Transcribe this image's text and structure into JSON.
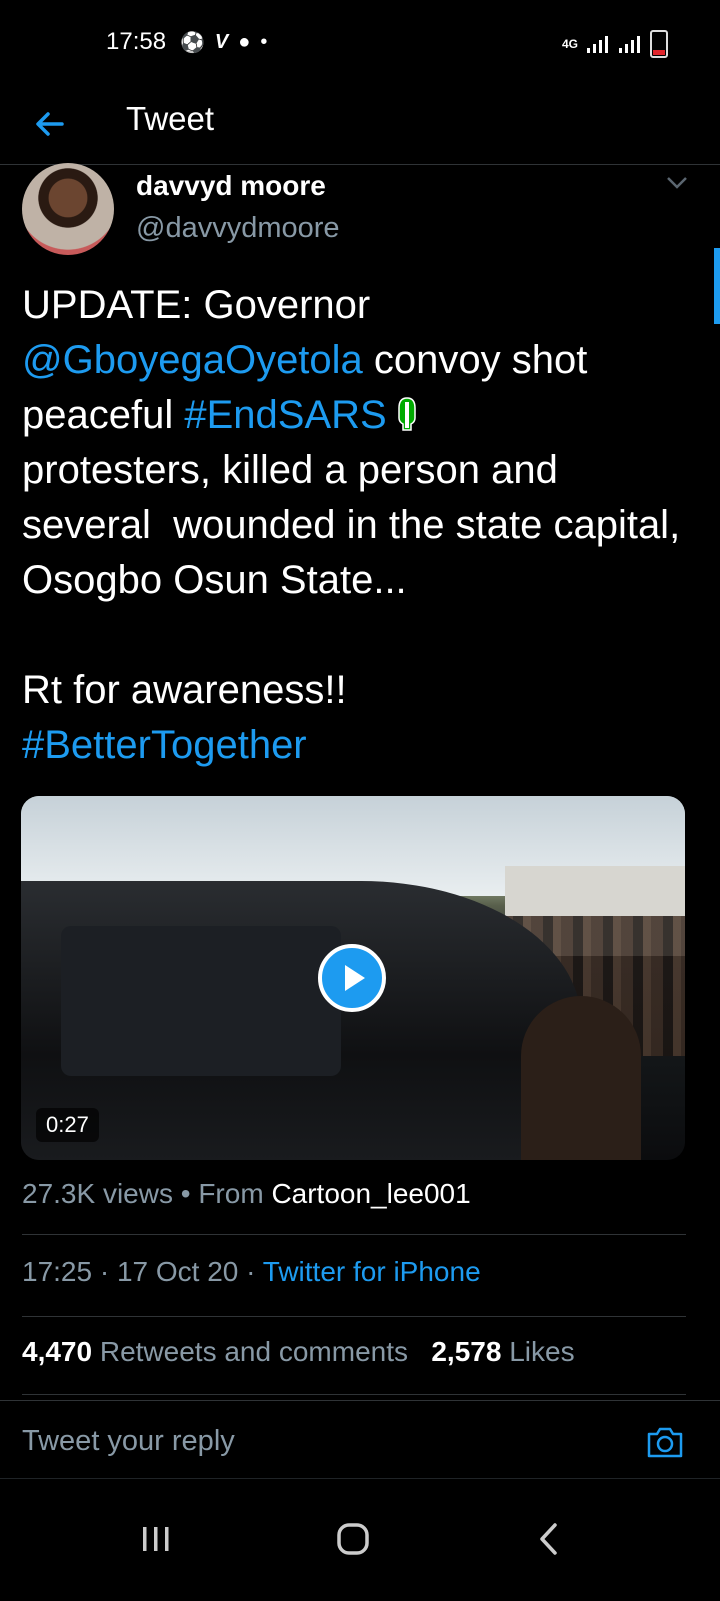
{
  "status_bar": {
    "time": "17:58",
    "left_icons": [
      "soccer-ball-icon",
      "v-icon",
      "whatsapp-icon",
      "dot-icon"
    ],
    "left_glyphs": [
      "⚽",
      "V",
      "●",
      "•"
    ],
    "network_label": "4G",
    "battery_level": 0.15
  },
  "header": {
    "title": "Tweet"
  },
  "author": {
    "name": "davvyd moore",
    "handle": "@davvydmoore"
  },
  "tweet": {
    "text_parts": {
      "p1": "UPDATE: Governor ",
      "mention": "@GboyegaOyetola",
      "p2": " convoy shot peaceful ",
      "hashtag1": "#EndSARS",
      "p3": "\nprotesters, killed a person and several  wounded in the state capital, Osogbo Osun State...\n\nRt for awareness!!\n",
      "hashtag2": "#BetterTogether"
    }
  },
  "media": {
    "duration": "0:27"
  },
  "views_line": {
    "views": "27.3K views",
    "sep": " • From ",
    "source": "Cartoon_lee001"
  },
  "meta": {
    "time": "17:25",
    "date": "17 Oct 20",
    "via": "Twitter for iPhone",
    "dot1": " · ",
    "dot2": " · "
  },
  "stats": {
    "retweets": "4,470",
    "retweets_label": "Retweets and comments",
    "likes": "2,578",
    "likes_label": "Likes"
  },
  "reply": {
    "placeholder": "Tweet your reply"
  },
  "colors": {
    "accent": "#1d9bf0",
    "muted": "#8899a6",
    "background": "#000000"
  }
}
